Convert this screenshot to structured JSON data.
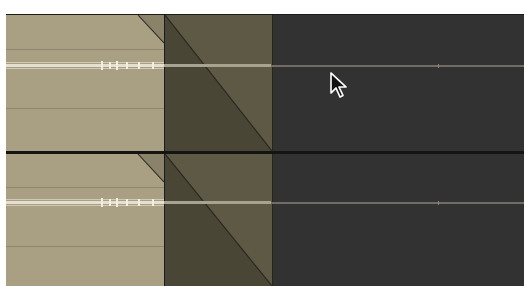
{
  "editor": {
    "tracks": [
      {
        "id": "track-1",
        "fade": "crossfade"
      },
      {
        "id": "track-2",
        "fade": "crossfade"
      }
    ],
    "colors": {
      "clip": "#a9a084",
      "fade": "#58533f",
      "background": "#333232",
      "waveform": "#e8e4d6"
    },
    "cursor": {
      "icon": "arrow-pointer-icon"
    }
  }
}
